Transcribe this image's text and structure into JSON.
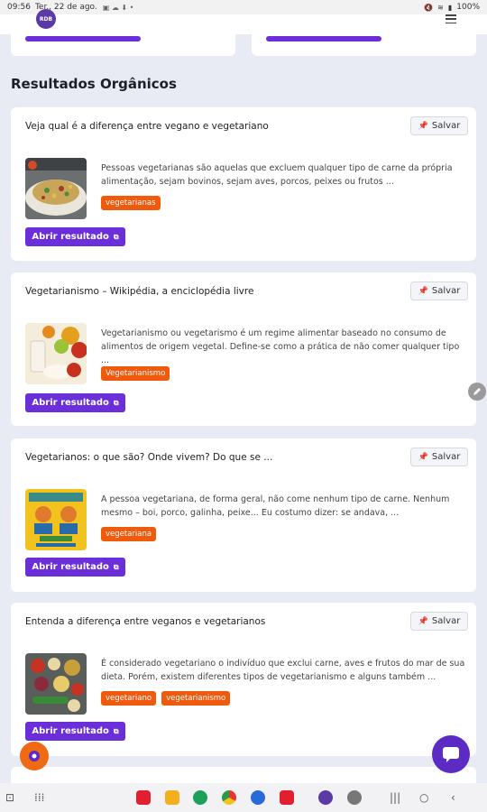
{
  "status": {
    "time": "09:56",
    "date": "Ter., 22 de ago.",
    "battery": "100%"
  },
  "header": {
    "logo_text": "RDB"
  },
  "section_title": "Resultados Orgânicos",
  "save_label": "Salvar",
  "open_label": "Abrir resultado",
  "results": [
    {
      "title": "Veja qual é a diferença entre vegano e vegetariano",
      "description": "Pessoas vegetarianas são aquelas que excluem qualquer tipo de carne da própria alimentação, sejam bovinos, sejam aves, porcos, peixes ou frutos ...",
      "tags": [
        "vegetarianas"
      ]
    },
    {
      "title": "Vegetarianismo – Wikipédia, a enciclopédia livre",
      "description": "Vegetarianismo ou vegetarismo é um regime alimentar baseado no consumo de alimentos de origem vegetal. Define-se como a prática de não comer qualquer tipo ...",
      "tags": [
        "Vegetarianismo"
      ]
    },
    {
      "title": "Vegetarianos: o que são? Onde vivem? Do que se ...",
      "description": "A pessoa vegetariana, de forma geral, não come nenhum tipo de carne. Nenhum mesmo – boi, porco, galinha, peixe... Eu costumo dizer: se andava, ...",
      "tags": [
        "vegetariana"
      ]
    },
    {
      "title": "Entenda a diferença entre veganos e vegetarianos",
      "description": "É considerado vegetariano o indivíduo que exclui carne, aves e frutos do mar de sua dieta. Porém, existem diferentes tipos de vegetarianismo e alguns também ...",
      "tags": [
        "vegetariano",
        "vegetarianismo"
      ]
    }
  ],
  "colors": {
    "accent": "#6a2fd8",
    "tag": "#ef5a0c",
    "background": "#e8ebf3"
  },
  "icons": {
    "pin": "pin-icon",
    "external": "external-link-icon",
    "menu": "hamburger-menu-icon",
    "chat": "chat-icon",
    "edit": "pencil-icon"
  }
}
